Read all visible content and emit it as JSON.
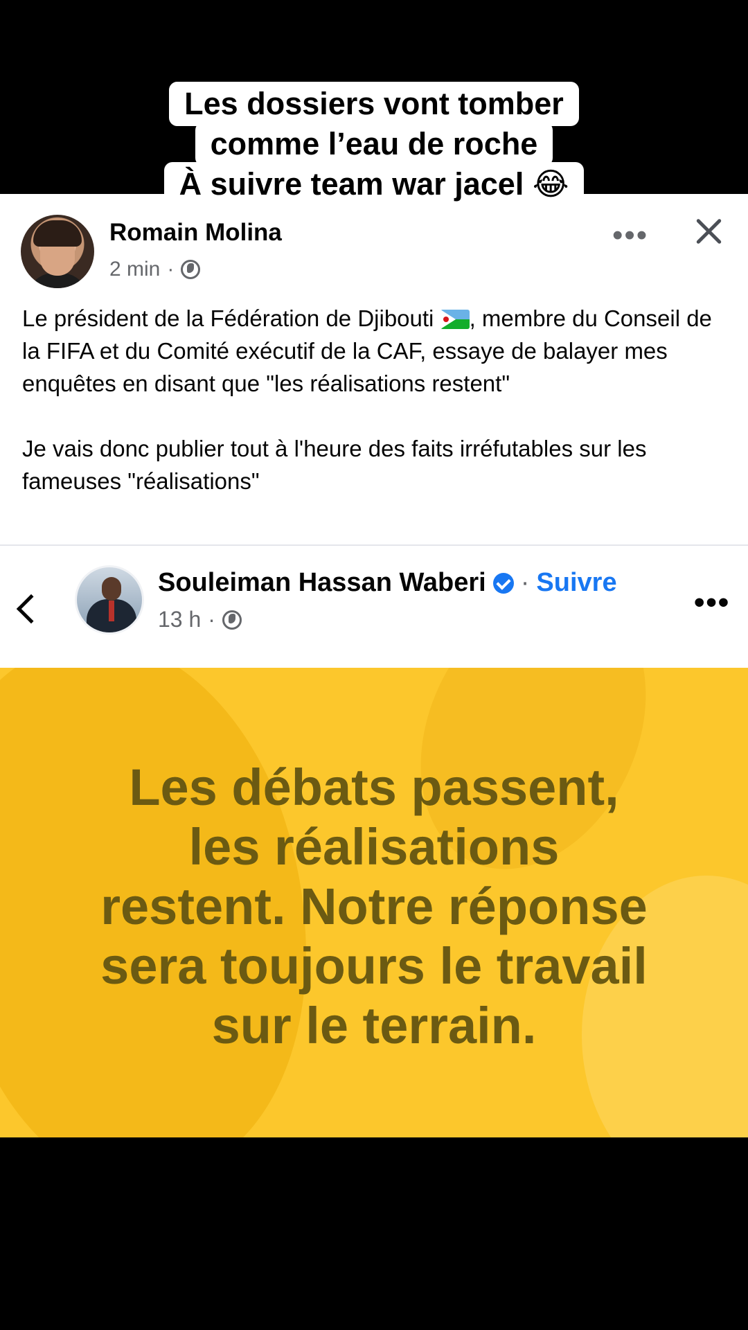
{
  "caption": {
    "lines": [
      "Les dossiers vont tomber",
      "comme l’eau de roche",
      "À suivre team war jacel 😂"
    ]
  },
  "post": {
    "author": "Romain Molina",
    "time": "2 min",
    "separator": "·",
    "more_label": "•••",
    "body_part1": "Le président de la Fédération de Djibouti",
    "body_part1b": ", membre du Conseil de la FIFA et du Comité exécutif de la CAF, essaye de balayer mes enquêtes en disant que \"les réalisations restent\"",
    "body_part2": "Je vais donc publier tout à l'heure des faits irréfutables sur les fameuses \"réalisations\""
  },
  "embedded": {
    "author": "Souleiman Hassan Waberi",
    "separator": "·",
    "follow_label": "Suivre",
    "time": "13 h",
    "more_label": "•••",
    "quote_lines": [
      "Les débats passent,",
      "les réalisations",
      "restent. Notre réponse",
      "sera toujours le travail",
      "sur le terrain."
    ]
  },
  "colors": {
    "facebook_blue": "#1877f2",
    "quote_background": "#fcc72c",
    "quote_text": "#6b5a12"
  }
}
